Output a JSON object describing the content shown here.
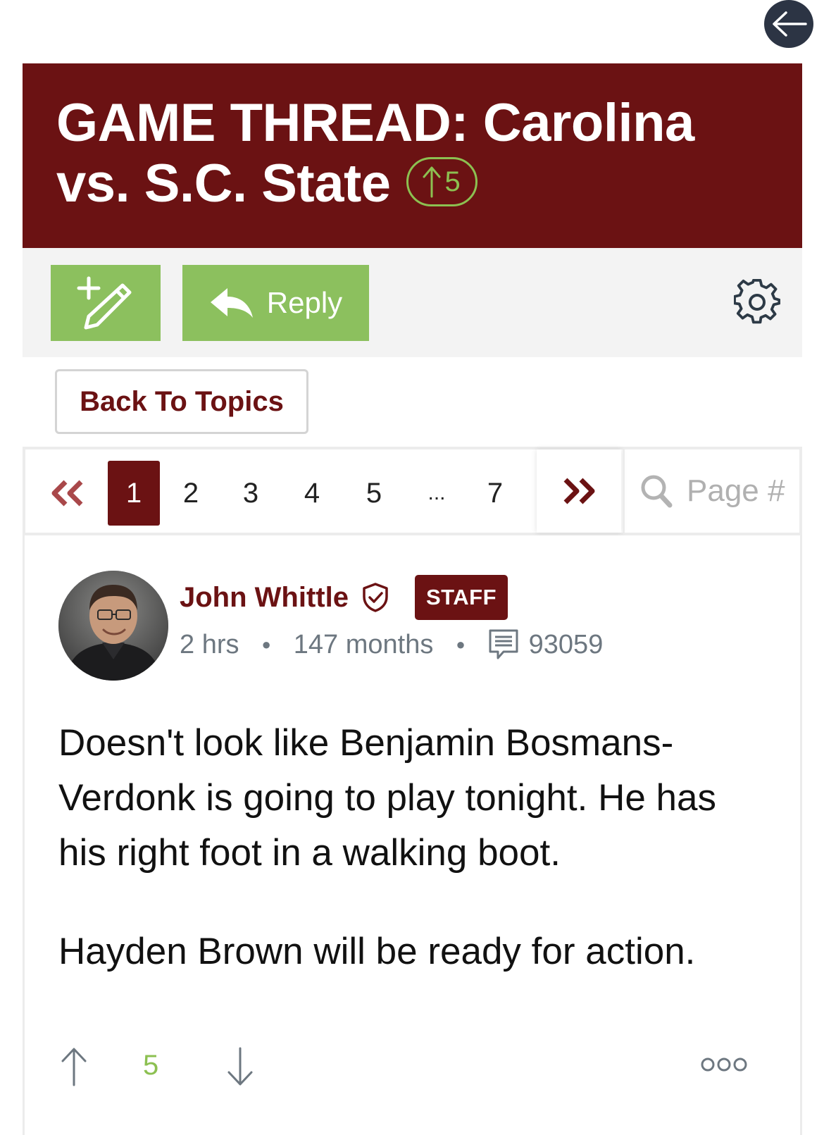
{
  "thread": {
    "title": "GAME THREAD: Carolina vs. S.C. State",
    "vote_count": "5"
  },
  "toolbar": {
    "reply_label": "Reply"
  },
  "nav": {
    "back_to_topics": "Back To Topics"
  },
  "pagination": {
    "pages": [
      "1",
      "2",
      "3",
      "4",
      "5",
      "...",
      "7"
    ],
    "active_page": "1",
    "search_placeholder": "Page #"
  },
  "post": {
    "author": "John Whittle",
    "badge": "STAFF",
    "posted": "2 hrs",
    "member_for": "147 months",
    "post_count": "93059",
    "paragraphs": [
      "Doesn't look like Benjamin Bosmans-Verdonk is going to play tonight. He has his right foot in a walking boot.",
      "Hayden Brown will be ready for action."
    ],
    "score": "5"
  },
  "colors": {
    "brand_maroon": "#6b1213",
    "action_green": "#8cc05e",
    "score_green": "#8cc051",
    "fab_navy": "#2c3444"
  },
  "icons": {
    "back": "arrow-left-icon",
    "new_topic": "pencil-plus-icon",
    "reply": "reply-arrow-icon",
    "settings": "gear-icon",
    "first_page": "double-chevron-left-icon",
    "next_page": "double-chevron-right-icon",
    "search": "search-icon",
    "verified": "shield-check-icon",
    "posts": "message-icon",
    "upvote": "arrow-up-icon",
    "downvote": "arrow-down-icon",
    "more": "more-icon"
  }
}
